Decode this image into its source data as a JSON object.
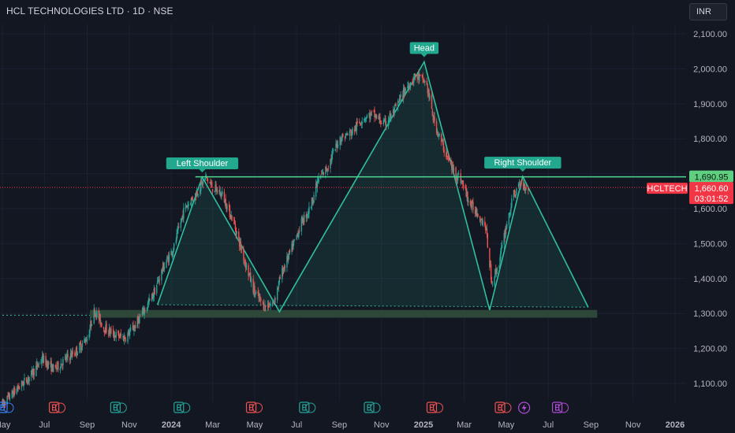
{
  "header": {
    "title": "HCL TECHNOLOGIES LTD · 1D · NSE",
    "currency": "INR"
  },
  "chart_data": {
    "type": "candlestick",
    "symbol": "HCLTECH",
    "y_ticks": [
      1100,
      1200,
      1300,
      1400,
      1500,
      1600,
      1700,
      1800,
      1900,
      2000,
      2100
    ],
    "ylim": [
      1060,
      2150
    ],
    "x_ticks": [
      {
        "label": "May",
        "date": "2023-05-01"
      },
      {
        "label": "Jul",
        "date": "2023-07-01"
      },
      {
        "label": "Sep",
        "date": "2023-09-01"
      },
      {
        "label": "Nov",
        "date": "2023-11-01"
      },
      {
        "label": "2024",
        "date": "2024-01-01",
        "bold": true
      },
      {
        "label": "Mar",
        "date": "2024-03-01"
      },
      {
        "label": "May",
        "date": "2024-05-01"
      },
      {
        "label": "Jul",
        "date": "2024-07-01"
      },
      {
        "label": "Sep",
        "date": "2024-09-01"
      },
      {
        "label": "Nov",
        "date": "2024-11-01"
      },
      {
        "label": "2025",
        "date": "2025-01-01",
        "bold": true
      },
      {
        "label": "Mar",
        "date": "2025-03-01"
      },
      {
        "label": "May",
        "date": "2025-05-01"
      },
      {
        "label": "Jul",
        "date": "2025-07-01"
      },
      {
        "label": "Sep",
        "date": "2025-09-01"
      },
      {
        "label": "Nov",
        "date": "2025-11-01"
      },
      {
        "label": "2026",
        "date": "2026-01-01",
        "bold": true
      }
    ],
    "price_path": [
      [
        "2023-05-01",
        1040
      ],
      [
        "2023-05-20",
        1080
      ],
      [
        "2023-06-10",
        1120
      ],
      [
        "2023-06-28",
        1170
      ],
      [
        "2023-07-15",
        1140
      ],
      [
        "2023-08-01",
        1170
      ],
      [
        "2023-08-15",
        1190
      ],
      [
        "2023-09-01",
        1230
      ],
      [
        "2023-09-12",
        1310
      ],
      [
        "2023-09-25",
        1260
      ],
      [
        "2023-10-10",
        1240
      ],
      [
        "2023-10-25",
        1230
      ],
      [
        "2023-11-08",
        1260
      ],
      [
        "2023-11-20",
        1300
      ],
      [
        "2023-12-05",
        1350
      ],
      [
        "2023-12-20",
        1430
      ],
      [
        "2024-01-05",
        1490
      ],
      [
        "2024-01-20",
        1600
      ],
      [
        "2024-02-05",
        1640
      ],
      [
        "2024-02-20",
        1690
      ],
      [
        "2024-03-01",
        1660
      ],
      [
        "2024-03-15",
        1640
      ],
      [
        "2024-04-01",
        1560
      ],
      [
        "2024-04-15",
        1460
      ],
      [
        "2024-05-01",
        1360
      ],
      [
        "2024-05-15",
        1320
      ],
      [
        "2024-05-28",
        1330
      ],
      [
        "2024-06-10",
        1420
      ],
      [
        "2024-06-25",
        1490
      ],
      [
        "2024-07-08",
        1560
      ],
      [
        "2024-07-20",
        1600
      ],
      [
        "2024-08-01",
        1680
      ],
      [
        "2024-08-15",
        1720
      ],
      [
        "2024-09-01",
        1800
      ],
      [
        "2024-09-20",
        1820
      ],
      [
        "2024-10-05",
        1860
      ],
      [
        "2024-10-20",
        1870
      ],
      [
        "2024-11-05",
        1840
      ],
      [
        "2024-11-20",
        1880
      ],
      [
        "2024-12-05",
        1940
      ],
      [
        "2024-12-20",
        1980
      ],
      [
        "2025-01-05",
        1960
      ],
      [
        "2025-01-15",
        1860
      ],
      [
        "2025-01-25",
        1800
      ],
      [
        "2025-02-10",
        1720
      ],
      [
        "2025-02-25",
        1680
      ],
      [
        "2025-03-10",
        1610
      ],
      [
        "2025-03-20",
        1590
      ],
      [
        "2025-04-01",
        1550
      ],
      [
        "2025-04-10",
        1390
      ],
      [
        "2025-04-20",
        1440
      ],
      [
        "2025-05-01",
        1550
      ],
      [
        "2025-05-12",
        1640
      ],
      [
        "2025-05-22",
        1670
      ],
      [
        "2025-06-02",
        1660
      ]
    ],
    "pattern": {
      "name": "Head and Shoulders",
      "points": [
        {
          "date": "2023-12-12",
          "price": 1325
        },
        {
          "date": "2024-02-15",
          "price": 1690
        },
        {
          "date": "2024-06-06",
          "price": 1305
        },
        {
          "date": "2025-01-02",
          "price": 2020
        },
        {
          "date": "2025-04-07",
          "price": 1310
        },
        {
          "date": "2025-05-25",
          "price": 1692
        },
        {
          "date": "2025-08-28",
          "price": 1318
        }
      ],
      "labels": [
        {
          "text": "Left Shoulder",
          "date": "2024-02-15",
          "price": 1690
        },
        {
          "text": "Head",
          "date": "2025-01-02",
          "price": 2020
        },
        {
          "text": "Right Shoulder",
          "date": "2025-05-25",
          "price": 1692
        }
      ],
      "neckline_resistance": {
        "price": 1690.95,
        "from": "2024-02-05",
        "to": "2026-01-31"
      },
      "support_zone": {
        "low": 1288,
        "high": 1310,
        "from": "2023-09-05",
        "to": "2025-09-10"
      },
      "support_dotted": {
        "price": 1295,
        "from": "2023-05-01",
        "to": "2023-09-05"
      }
    },
    "current_price": {
      "symbol_label": "HCLTECH",
      "price": "1,660.60",
      "price_value": 1660.6,
      "countdown": "03:01:52",
      "neckline_label": "1,690.95"
    },
    "event_markers": [
      {
        "type": "E",
        "date": "2023-05-01",
        "color": "#3b82f6"
      },
      {
        "type": "E",
        "date": "2023-07-15",
        "color": "#ef5350"
      },
      {
        "type": "E",
        "date": "2023-10-12",
        "color": "#26a69a"
      },
      {
        "type": "E",
        "date": "2024-01-12",
        "color": "#26a69a"
      },
      {
        "type": "E",
        "date": "2024-04-26",
        "color": "#ef5350"
      },
      {
        "type": "E",
        "date": "2024-07-12",
        "color": "#26a69a"
      },
      {
        "type": "E",
        "date": "2024-10-14",
        "color": "#26a69a"
      },
      {
        "type": "E",
        "date": "2025-01-13",
        "color": "#ef5350"
      },
      {
        "type": "E",
        "date": "2025-04-22",
        "color": "#ef5350"
      },
      {
        "type": "lightning",
        "date": "2025-05-27",
        "color": "#b04bd6"
      },
      {
        "type": "E",
        "date": "2025-07-14",
        "color": "#b04bd6"
      }
    ],
    "colors": {
      "background": "#131722",
      "up": "#26a69a",
      "down": "#ef5350",
      "pattern": "#2fbf9f",
      "neckline": "#4fd88f",
      "support": "#2e4a3a",
      "price_label": "#f23645",
      "neckline_label": "#5fd07f",
      "grid": "#1c2030",
      "axis_text": "#b2b5be"
    }
  }
}
